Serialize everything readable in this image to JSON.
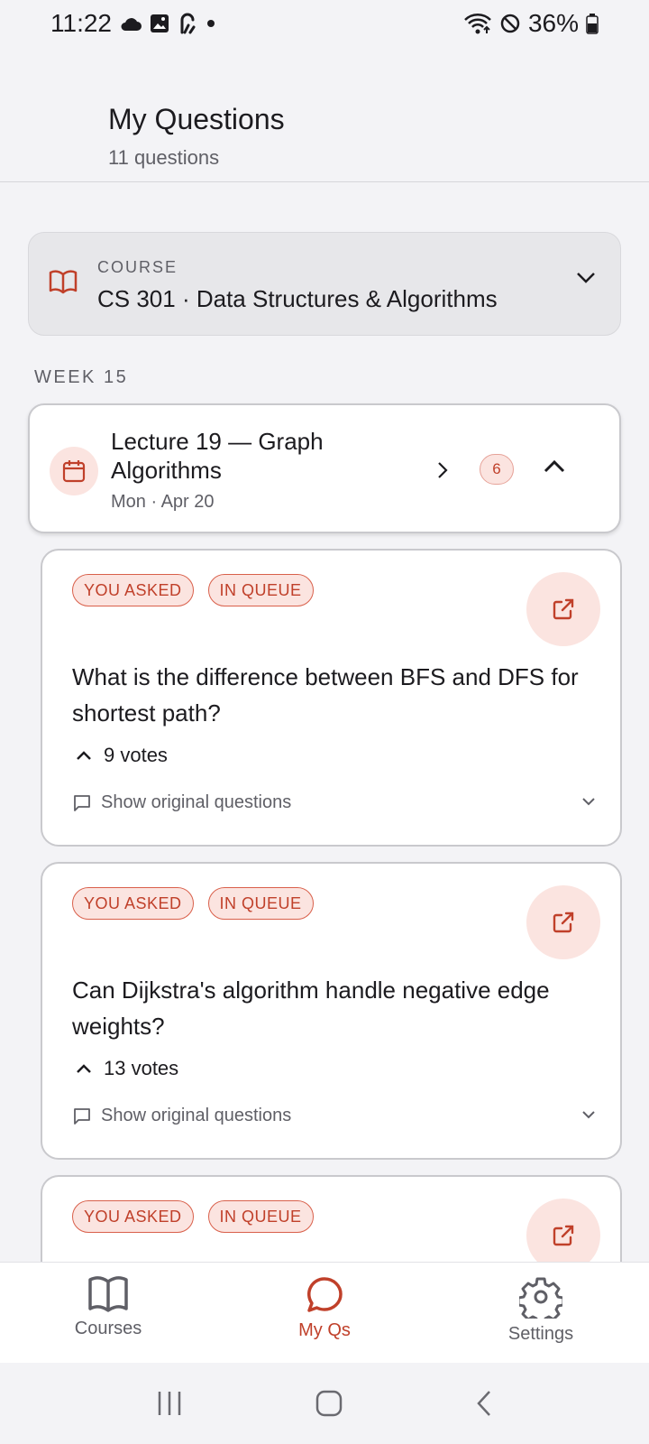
{
  "status_bar": {
    "time": "11:22",
    "battery": "36%",
    "icons": [
      "cloud-icon",
      "image-icon",
      "assistant-icon",
      "dot-icon",
      "wifi-icon",
      "dnd-icon",
      "battery-icon"
    ]
  },
  "header": {
    "title": "My Questions",
    "subtitle": "11 questions"
  },
  "course": {
    "label": "COURSE",
    "name": "CS 301 · Data Structures & Algorithms",
    "icon": "book-icon"
  },
  "week": {
    "label": "WEEK 15"
  },
  "lecture": {
    "title": "Lecture 19 — Graph Algorithms",
    "date": "Mon · Apr 20",
    "count": "6",
    "icon": "calendar-icon"
  },
  "questions": [
    {
      "tags": [
        "YOU ASKED",
        "IN QUEUE"
      ],
      "text": "What is the difference between BFS and DFS for shortest path?",
      "votes": "9 votes",
      "original_label": "Show original questions"
    },
    {
      "tags": [
        "YOU ASKED",
        "IN QUEUE"
      ],
      "text": "Can Dijkstra's algorithm handle negative edge weights?",
      "votes": "13 votes",
      "original_label": "Show original questions"
    },
    {
      "tags": [
        "YOU ASKED",
        "IN QUEUE"
      ]
    }
  ],
  "bottom_nav": {
    "items": [
      {
        "label": "Courses",
        "icon": "book-icon",
        "active": false
      },
      {
        "label": "My Qs",
        "icon": "chat-bubble-icon",
        "active": true
      },
      {
        "label": "Settings",
        "icon": "gear-icon",
        "active": false
      }
    ]
  },
  "colors": {
    "accent": "#c0402a",
    "accent_soft": "#fbe4e0",
    "background": "#f3f3f6"
  }
}
